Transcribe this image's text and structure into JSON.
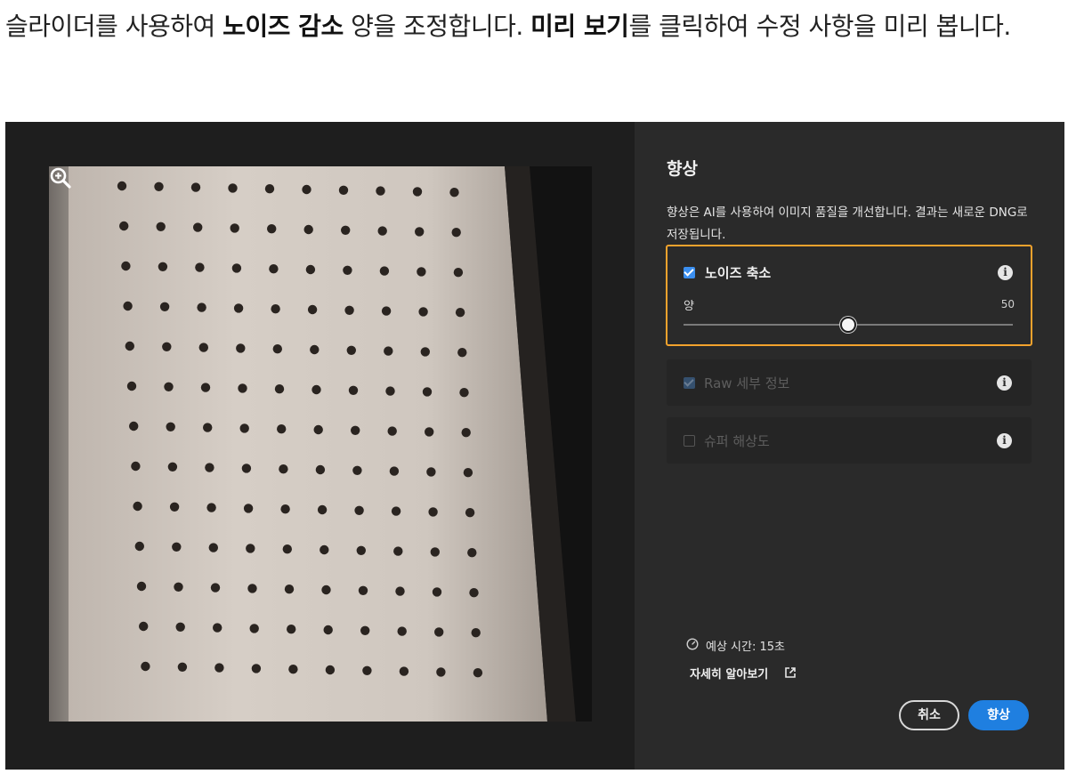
{
  "instruction": {
    "part1": "슬라이더를 사용하여 ",
    "bold1": "노이즈 감소",
    "part2": " 양을 조정합니다. ",
    "bold2": "미리 보기",
    "part3": "를 클릭하여 수정 사항을 미리 봅니다."
  },
  "panel": {
    "title": "향상",
    "description": "향상은 AI를 사용하여 이미지 품질을 개선합니다. 결과는 새로운 DNG로 저장됩니다.",
    "options": {
      "noise_reduction": {
        "label": "노이즈 축소",
        "checked": true,
        "slider_label": "양",
        "slider_value": "50",
        "slider_fraction": 0.5
      },
      "raw_details": {
        "label": "Raw 세부 정보",
        "checked": true,
        "disabled": true
      },
      "super_resolution": {
        "label": "슈퍼 해상도",
        "checked": false,
        "disabled": true
      }
    },
    "estimate": "예상 시간: 15초",
    "learn_more": "자세히 알아보기",
    "cancel_label": "취소",
    "enhance_label": "향상"
  },
  "icons": {
    "info": "info-icon",
    "zoom": "zoom-in-icon",
    "clock": "clock-icon",
    "external": "external-link-icon"
  },
  "colors": {
    "highlight": "#f2a22d",
    "accent": "#1f7fe0",
    "panel_bg": "#2a2a2a",
    "preview_bg": "#1e1e1e"
  }
}
